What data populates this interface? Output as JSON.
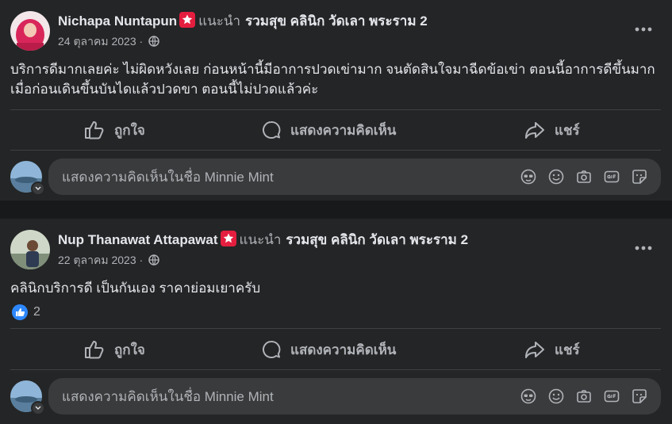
{
  "colors": {
    "accent": "#2d88ff",
    "badge": "#e41e3f",
    "card": "#242526",
    "background": "#18191a",
    "text": "#e4e6eb",
    "muted": "#b0b3b8"
  },
  "posts": [
    {
      "author": "Nichapa Nuntapun",
      "recommends": "แนะนำ",
      "page": "รวมสุข คลินิก วัดเลา พระราม 2",
      "date": "24 ตุลาคม 2023",
      "date_sep": "·",
      "text": "บริการดีมากเลยค่ะ ไม่ผิดหวังเลย ก่อนหน้านี้มีอาการปวดเข่ามาก จนตัดสินใจมาฉีดข้อเข่า ตอนนี้อาการดีขึ้นมาก เมื่อก่อนเดินขึ้นบันไดแล้วปวดขา ตอนนี้ไม่ปวดแล้วค่ะ",
      "reaction_count": ""
    },
    {
      "author": "Nup Thanawat Attapawat",
      "recommends": "แนะนำ",
      "page": "รวมสุข คลินิก วัดเลา พระราม 2",
      "date": "22 ตุลาคม 2023",
      "date_sep": "·",
      "text": "คลินิกบริการดี เป็นกันเอง ราคาย่อมเยาครับ",
      "reaction_count": "2"
    }
  ],
  "actions": {
    "like": "ถูกใจ",
    "comment": "แสดงความคิดเห็น",
    "share": "แชร์"
  },
  "comment_box": {
    "placeholder": "แสดงความคิดเห็นในชื่อ Minnie Mint"
  },
  "icons": [
    "recommend-star-icon",
    "globe-icon",
    "more-dots-icon",
    "like-thumb-icon",
    "comment-bubble-icon",
    "share-arrow-icon",
    "avatar-effects-icon",
    "emoji-icon",
    "camera-icon",
    "gif-icon",
    "sticker-icon"
  ]
}
